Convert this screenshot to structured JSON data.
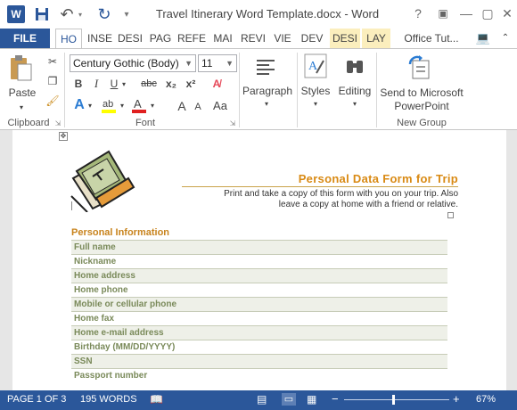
{
  "app": {
    "title": "Travel Itinerary Word Template.docx - Word",
    "logo_letter": "W",
    "qat_icons": [
      "save-icon",
      "undo-icon",
      "redo-icon",
      "customize-icon"
    ],
    "window_buttons": [
      "?",
      "▣",
      "—",
      "▢",
      "✕"
    ],
    "signin": "Office Tut..."
  },
  "tabs": [
    {
      "label": "FILE"
    },
    {
      "label": "HO"
    },
    {
      "label": "INSE"
    },
    {
      "label": "DESI"
    },
    {
      "label": "PAG"
    },
    {
      "label": "REFE"
    },
    {
      "label": "MAI"
    },
    {
      "label": "REVI"
    },
    {
      "label": "VIE"
    },
    {
      "label": "DEV"
    },
    {
      "label": "DESI"
    },
    {
      "label": "LAY"
    }
  ],
  "ribbon": {
    "clipboard": {
      "paste_label": "Paste",
      "group_label": "Clipboard"
    },
    "font": {
      "font_name": "Century Gothic (Body)",
      "font_size": "11",
      "group_label": "Font",
      "bold": "B",
      "italic": "I",
      "underline": "U",
      "strike": "abc",
      "subscript": "x₂",
      "superscript": "x²",
      "grow": "A",
      "shrink": "A"
    },
    "paragraph": {
      "label": "Paragraph"
    },
    "styles": {
      "label": "Styles"
    },
    "editing": {
      "label": "Editing"
    },
    "send": {
      "label_line1": "Send to Microsoft",
      "label_line2": "PowerPoint",
      "group_label": "New Group"
    }
  },
  "document": {
    "title": "Personal Data Form for Trip",
    "subtitle_line1": "Print and take a copy of this form with you on your trip. Also",
    "subtitle_line2": "leave a copy at home with a friend or relative.",
    "section": "Personal Information",
    "fields": [
      "Full name",
      "Nickname",
      "Home address",
      "Home phone",
      "Mobile or cellular phone",
      "Home fax",
      "Home e-mail address",
      "Birthday (MM/DD/YYYY)",
      "SSN",
      "Passport number"
    ]
  },
  "status": {
    "page": "PAGE 1 OF 3",
    "words": "195 WORDS",
    "zoom": "67%"
  }
}
